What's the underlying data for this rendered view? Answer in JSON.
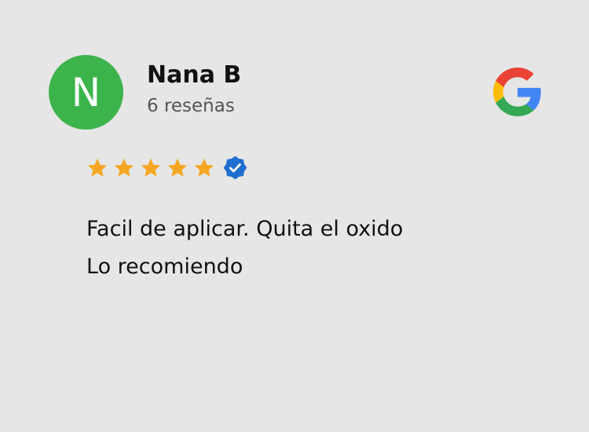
{
  "reviewer": {
    "initial": "N",
    "name": "Nana B",
    "review_count_text": "6 reseñas",
    "avatar_color": "#3cb44b"
  },
  "rating": {
    "stars": 5,
    "max_stars": 5,
    "star_color": "#f5a623",
    "verified_badge_color": "#1f6fd0"
  },
  "review": {
    "lines": [
      "Facil de aplicar. Quita el oxido",
      "Lo recomiendo"
    ]
  },
  "source": {
    "icon": "google-icon"
  },
  "colors": {
    "background": "#e6e6e6",
    "google_red": "#ea4335",
    "google_yellow": "#fbbc05",
    "google_green": "#34a853",
    "google_blue": "#4285f4"
  }
}
